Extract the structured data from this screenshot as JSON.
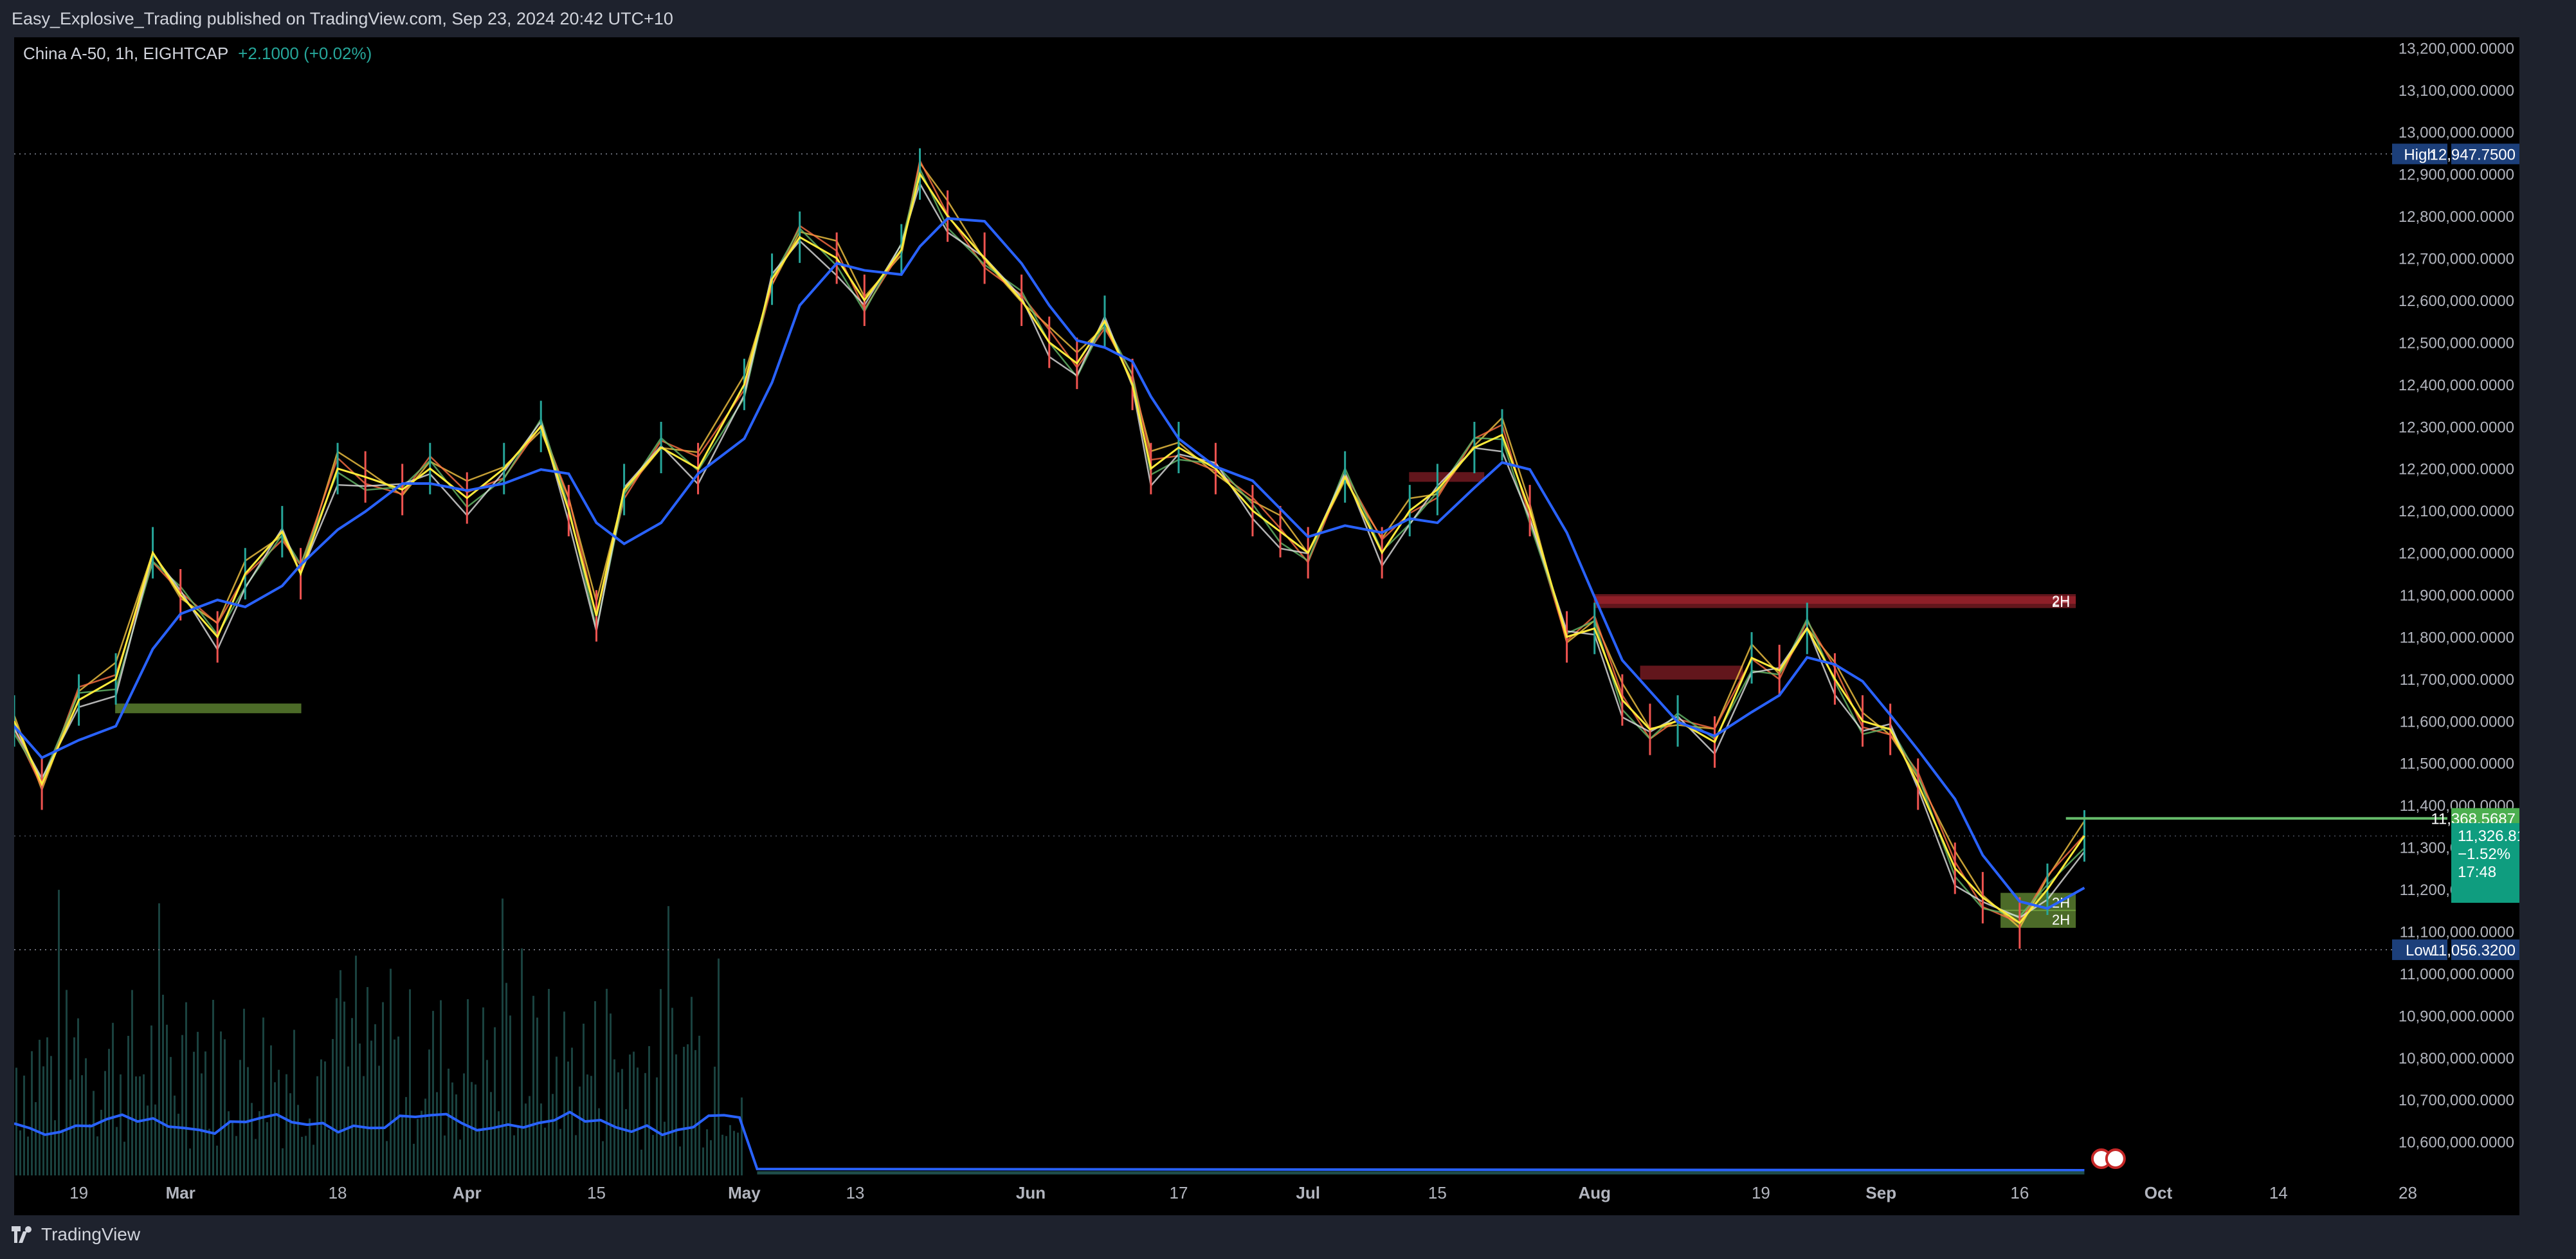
{
  "header": {
    "publisher_line": "Easy_Explosive_Trading published on TradingView.com, Sep 23, 2024 20:42 UTC+10"
  },
  "legend": {
    "symbol": "China A-50, 1h, EIGHTCAP",
    "change": "+2.1000 (+0.02%)"
  },
  "footer": {
    "brand": "TradingView"
  },
  "colors": {
    "background": "#000000",
    "frame": "#1e222d",
    "text": "#d1d4dc",
    "axis_text": "#b2b5be",
    "up": "#26a69a",
    "zone_red": "#b22833",
    "zone_green": "#8bc34a",
    "ma_blue": "#2962ff",
    "high_low_tag": "#1c3f7a",
    "price_tag": "#0f9d7f",
    "green_tag": "#4caf50"
  },
  "chart_data": {
    "type": "line",
    "title": "China A-50, 1h, EIGHTCAP",
    "y_ticks": [
      "13,200,000.0",
      "13,100,000.0",
      "13,000,000.0",
      "12,900,000.0",
      "12,800,000.0",
      "12,700,000.0",
      "12,600,000.0",
      "12,500,000.0",
      "12,400,000.0",
      "12,300,000.0",
      "12,200,000.0",
      "12,100,000.0",
      "12,000,000.0",
      "11,900,000.0",
      "11,800,000.0",
      "11,700,000.0",
      "11,600,000.0",
      "11,500,000.0",
      "11,400,000.0",
      "11,300,000.0",
      "11,200,000.0",
      "11,100,000.0",
      "11,000,000.0",
      "10,900,000.0",
      "10,800,000.0",
      "10,700,000.0",
      "10,600,000.0"
    ],
    "y_tick_values": [
      13200,
      13100,
      13000,
      12900,
      12800,
      12700,
      12600,
      12500,
      12400,
      12300,
      12200,
      12100,
      12000,
      11900,
      11800,
      11700,
      11600,
      11500,
      11400,
      11300,
      11200,
      11100,
      11000,
      10900,
      10800,
      10700,
      10600
    ],
    "y_tick_text": [
      "13,200,000.0000",
      "13,100,000.0000",
      "13,000,000.0000",
      "12,900,000.0000",
      "12,800,000.0000",
      "12,700,000.0000",
      "12,600,000.0000",
      "12,500,000.0000",
      "12,400,000.0000",
      "12,300,000.0000",
      "12,200,000.0000",
      "12,100,000.0000",
      "12,000,000.0000",
      "11,900,000.0000",
      "11,800,000.0000",
      "11,700,000.0000",
      "11,600,000.0000",
      "11,500,000.0000",
      "11,400,000.0000",
      "11,300,000.0000",
      "11,200,000.0000",
      "11,100,000.0000",
      "11,000,000.0000",
      "10,900,000.0000",
      "10,800,000.0000",
      "10,700,000.0000",
      "10,600,000.0000"
    ],
    "x_ticks": [
      "19",
      "Mar",
      "18",
      "Apr",
      "15",
      "May",
      "13",
      "Jun",
      "17",
      "Jul",
      "15",
      "Aug",
      "19",
      "Sep",
      "16",
      "Oct",
      "14",
      "28"
    ],
    "x_tick_dates": [
      "2024-02-19",
      "2024-03-01",
      "2024-03-18",
      "2024-04-01",
      "2024-04-15",
      "2024-05-01",
      "2024-05-13",
      "2024-06-01",
      "2024-06-17",
      "2024-07-01",
      "2024-07-15",
      "2024-08-01",
      "2024-08-19",
      "2024-09-01",
      "2024-09-16",
      "2024-10-01",
      "2024-10-14",
      "2024-10-28"
    ],
    "ylim": [
      10520,
      13225
    ],
    "xlim": [
      "2024-02-12",
      "2024-11-01"
    ],
    "grid": false,
    "high": {
      "label": "High",
      "value": "12,947.7500",
      "price": 12947.75,
      "date": "2024-05-20"
    },
    "low": {
      "label": "Low",
      "value": "11,056.3200",
      "price": 11056.32,
      "date": "2024-09-18"
    },
    "last_price": {
      "value": "11,326.8100",
      "price": 11326.81,
      "change_pct": "−1.52%",
      "countdown": "17:48"
    },
    "green_line": {
      "value": "11,368.5687",
      "price": 11368.5687
    },
    "series": [
      {
        "values": [
          {
            "x": "2024-02-12",
            "y": 11600
          },
          {
            "x": "2024-02-15",
            "y": 11450
          },
          {
            "x": "2024-02-19",
            "y": 11650
          },
          {
            "x": "2024-02-23",
            "y": 11700
          },
          {
            "x": "2024-02-27",
            "y": 12000
          },
          {
            "x": "2024-03-01",
            "y": 11900
          },
          {
            "x": "2024-03-05",
            "y": 11800
          },
          {
            "x": "2024-03-08",
            "y": 11950
          },
          {
            "x": "2024-03-12",
            "y": 12050
          },
          {
            "x": "2024-03-14",
            "y": 11950
          },
          {
            "x": "2024-03-18",
            "y": 12200
          },
          {
            "x": "2024-03-21",
            "y": 12180
          },
          {
            "x": "2024-03-25",
            "y": 12150
          },
          {
            "x": "2024-03-28",
            "y": 12200
          },
          {
            "x": "2024-04-01",
            "y": 12130
          },
          {
            "x": "2024-04-05",
            "y": 12200
          },
          {
            "x": "2024-04-09",
            "y": 12300
          },
          {
            "x": "2024-04-12",
            "y": 12100
          },
          {
            "x": "2024-04-15",
            "y": 11850
          },
          {
            "x": "2024-04-18",
            "y": 12150
          },
          {
            "x": "2024-04-22",
            "y": 12250
          },
          {
            "x": "2024-04-26",
            "y": 12200
          },
          {
            "x": "2024-05-01",
            "y": 12400
          },
          {
            "x": "2024-05-04",
            "y": 12650
          },
          {
            "x": "2024-05-07",
            "y": 12750
          },
          {
            "x": "2024-05-11",
            "y": 12700
          },
          {
            "x": "2024-05-14",
            "y": 12600
          },
          {
            "x": "2024-05-18",
            "y": 12720
          },
          {
            "x": "2024-05-20",
            "y": 12900
          },
          {
            "x": "2024-05-23",
            "y": 12800
          },
          {
            "x": "2024-05-27",
            "y": 12700
          },
          {
            "x": "2024-05-31",
            "y": 12600
          },
          {
            "x": "2024-06-03",
            "y": 12500
          },
          {
            "x": "2024-06-06",
            "y": 12450
          },
          {
            "x": "2024-06-09",
            "y": 12550
          },
          {
            "x": "2024-06-12",
            "y": 12400
          },
          {
            "x": "2024-06-14",
            "y": 12200
          },
          {
            "x": "2024-06-17",
            "y": 12250
          },
          {
            "x": "2024-06-21",
            "y": 12200
          },
          {
            "x": "2024-06-25",
            "y": 12100
          },
          {
            "x": "2024-06-28",
            "y": 12050
          },
          {
            "x": "2024-07-01",
            "y": 12000
          },
          {
            "x": "2024-07-05",
            "y": 12180
          },
          {
            "x": "2024-07-09",
            "y": 12000
          },
          {
            "x": "2024-07-12",
            "y": 12100
          },
          {
            "x": "2024-07-15",
            "y": 12150
          },
          {
            "x": "2024-07-19",
            "y": 12250
          },
          {
            "x": "2024-07-22",
            "y": 12280
          },
          {
            "x": "2024-07-25",
            "y": 12100
          },
          {
            "x": "2024-07-29",
            "y": 11800
          },
          {
            "x": "2024-08-01",
            "y": 11820
          },
          {
            "x": "2024-08-04",
            "y": 11650
          },
          {
            "x": "2024-08-07",
            "y": 11580
          },
          {
            "x": "2024-08-10",
            "y": 11600
          },
          {
            "x": "2024-08-14",
            "y": 11550
          },
          {
            "x": "2024-08-18",
            "y": 11750
          },
          {
            "x": "2024-08-21",
            "y": 11720
          },
          {
            "x": "2024-08-24",
            "y": 11820
          },
          {
            "x": "2024-08-27",
            "y": 11700
          },
          {
            "x": "2024-08-30",
            "y": 11600
          },
          {
            "x": "2024-09-02",
            "y": 11580
          },
          {
            "x": "2024-09-05",
            "y": 11450
          },
          {
            "x": "2024-09-09",
            "y": 11250
          },
          {
            "x": "2024-09-12",
            "y": 11180
          },
          {
            "x": "2024-09-16",
            "y": 11120
          },
          {
            "x": "2024-09-19",
            "y": 11200
          },
          {
            "x": "2024-09-23",
            "y": 11327
          }
        ]
      }
    ],
    "zones": [
      {
        "kind": "supply",
        "from": "2024-08-01",
        "to": "2024-09-22",
        "top": 11900,
        "bottom": 11870,
        "label": "2H"
      },
      {
        "kind": "supply",
        "from": "2024-08-01",
        "to": "2024-09-22",
        "top": 11895,
        "bottom": 11880,
        "label": "2H"
      },
      {
        "kind": "demand",
        "from": "2024-09-14",
        "to": "2024-09-22",
        "top": 11190,
        "bottom": 11150,
        "label": "2H"
      },
      {
        "kind": "demand",
        "from": "2024-09-14",
        "to": "2024-09-22",
        "top": 11150,
        "bottom": 11110,
        "label": "2H"
      },
      {
        "kind": "demand",
        "from": "2024-02-23",
        "to": "2024-03-14",
        "top": 11640,
        "bottom": 11620,
        "label": ""
      },
      {
        "kind": "supply",
        "from": "2024-08-06",
        "to": "2024-08-17",
        "top": 11730,
        "bottom": 11700,
        "label": ""
      },
      {
        "kind": "supply",
        "from": "2024-07-12",
        "to": "2024-07-20",
        "top": 12190,
        "bottom": 12170,
        "label": ""
      }
    ],
    "volume_note": ""
  }
}
